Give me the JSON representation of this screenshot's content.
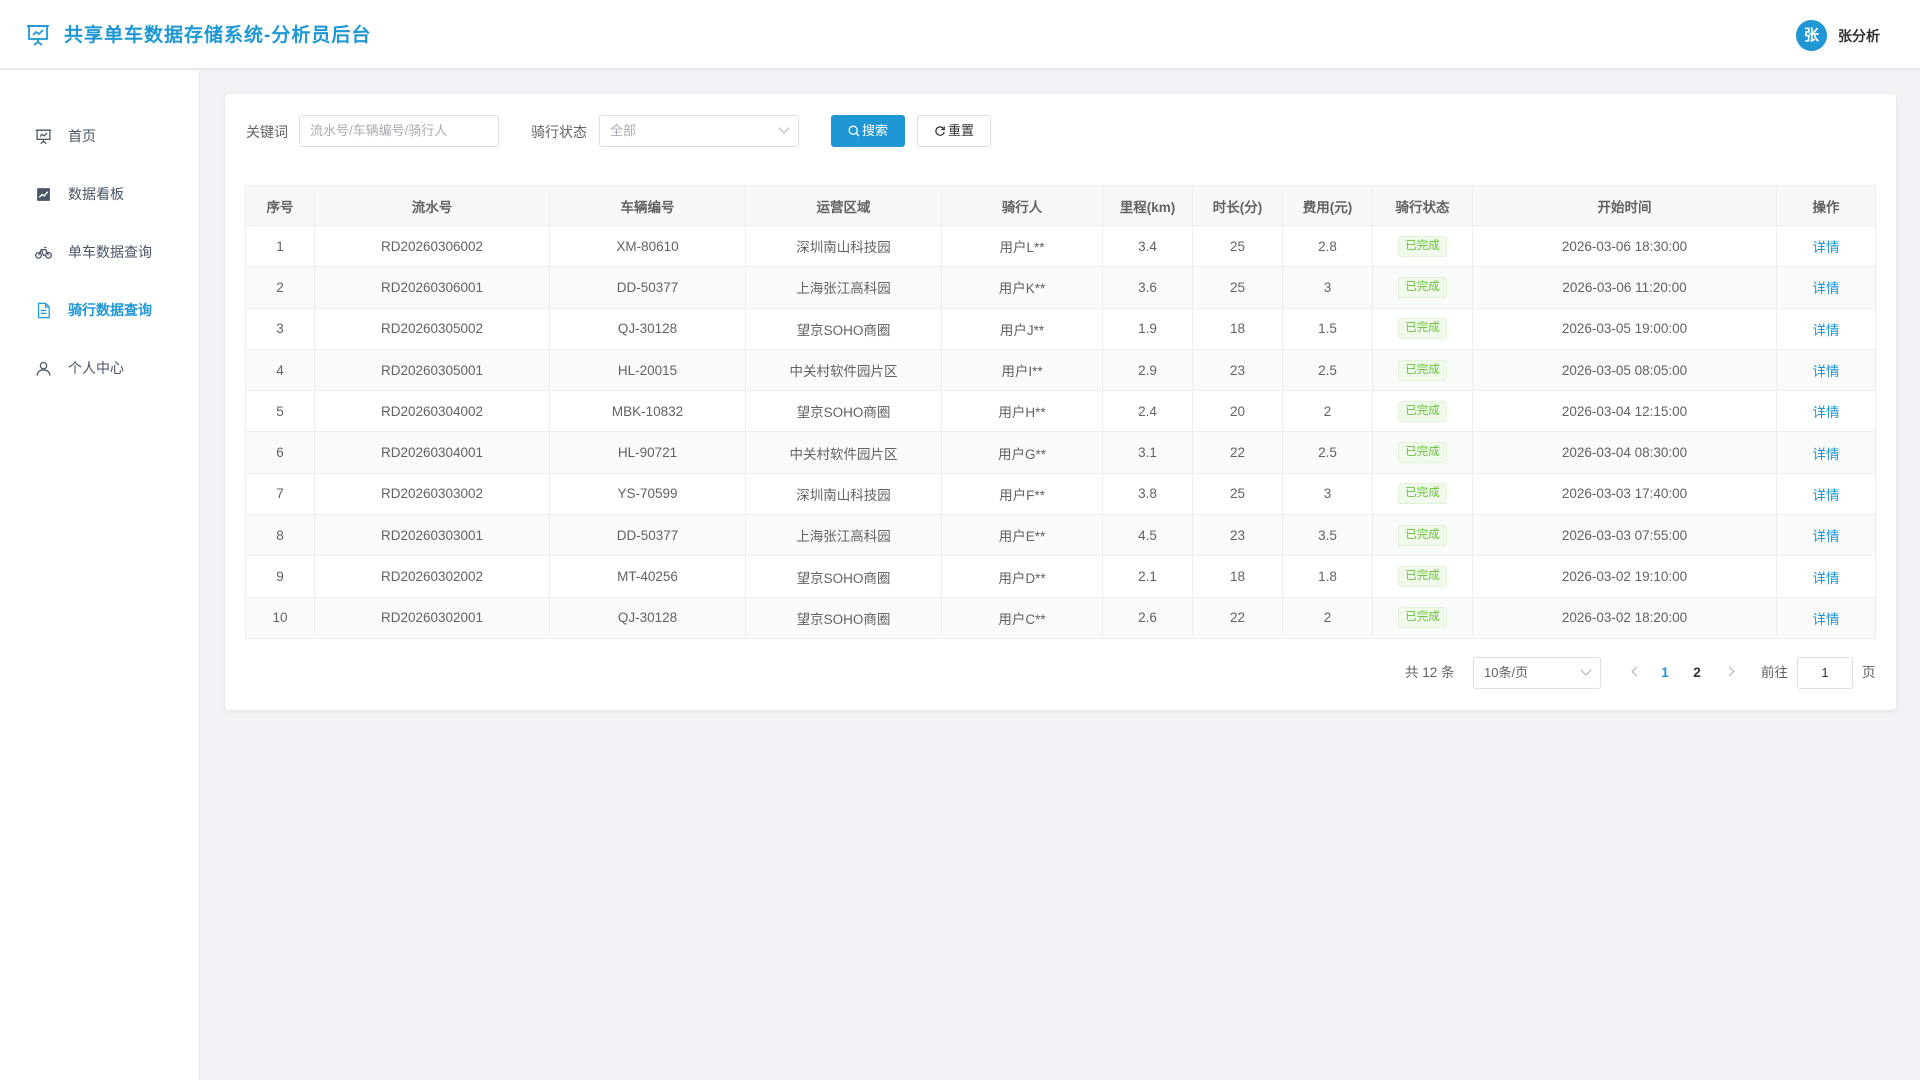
{
  "app": {
    "title": "共享单车数据存储系统-分析员后台",
    "accent_color": "#1e97d4"
  },
  "user": {
    "avatar_initial": "张",
    "name": "张分析"
  },
  "sidebar": {
    "items": [
      {
        "label": "首页",
        "icon": "presentation-icon",
        "active": false
      },
      {
        "label": "数据看板",
        "icon": "chart-icon",
        "active": false
      },
      {
        "label": "单车数据查询",
        "icon": "bicycle-icon",
        "active": false
      },
      {
        "label": "骑行数据查询",
        "icon": "document-icon",
        "active": true
      },
      {
        "label": "个人中心",
        "icon": "user-icon",
        "active": false
      }
    ]
  },
  "filters": {
    "keyword_label": "关键词",
    "keyword_placeholder": "流水号/车辆编号/骑行人",
    "status_label": "骑行状态",
    "status_value": "全部",
    "search_label": "搜索",
    "reset_label": "重置"
  },
  "table": {
    "columns": [
      "序号",
      "流水号",
      "车辆编号",
      "运营区域",
      "骑行人",
      "里程(km)",
      "时长(分)",
      "费用(元)",
      "骑行状态",
      "开始时间",
      "操作"
    ],
    "action_label": "详情",
    "rows": [
      {
        "idx": "1",
        "serial": "RD20260306002",
        "bike": "XM-80610",
        "area": "深圳南山科技园",
        "rider": "用户L**",
        "km": "3.4",
        "min": "25",
        "fee": "2.8",
        "status": "已完成",
        "start": "2026-03-06 18:30:00"
      },
      {
        "idx": "2",
        "serial": "RD20260306001",
        "bike": "DD-50377",
        "area": "上海张江高科园",
        "rider": "用户K**",
        "km": "3.6",
        "min": "25",
        "fee": "3",
        "status": "已完成",
        "start": "2026-03-06 11:20:00"
      },
      {
        "idx": "3",
        "serial": "RD20260305002",
        "bike": "QJ-30128",
        "area": "望京SOHO商圈",
        "rider": "用户J**",
        "km": "1.9",
        "min": "18",
        "fee": "1.5",
        "status": "已完成",
        "start": "2026-03-05 19:00:00"
      },
      {
        "idx": "4",
        "serial": "RD20260305001",
        "bike": "HL-20015",
        "area": "中关村软件园片区",
        "rider": "用户I**",
        "km": "2.9",
        "min": "23",
        "fee": "2.5",
        "status": "已完成",
        "start": "2026-03-05 08:05:00"
      },
      {
        "idx": "5",
        "serial": "RD20260304002",
        "bike": "MBK-10832",
        "area": "望京SOHO商圈",
        "rider": "用户H**",
        "km": "2.4",
        "min": "20",
        "fee": "2",
        "status": "已完成",
        "start": "2026-03-04 12:15:00"
      },
      {
        "idx": "6",
        "serial": "RD20260304001",
        "bike": "HL-90721",
        "area": "中关村软件园片区",
        "rider": "用户G**",
        "km": "3.1",
        "min": "22",
        "fee": "2.5",
        "status": "已完成",
        "start": "2026-03-04 08:30:00"
      },
      {
        "idx": "7",
        "serial": "RD20260303002",
        "bike": "YS-70599",
        "area": "深圳南山科技园",
        "rider": "用户F**",
        "km": "3.8",
        "min": "25",
        "fee": "3",
        "status": "已完成",
        "start": "2026-03-03 17:40:00"
      },
      {
        "idx": "8",
        "serial": "RD20260303001",
        "bike": "DD-50377",
        "area": "上海张江高科园",
        "rider": "用户E**",
        "km": "4.5",
        "min": "23",
        "fee": "3.5",
        "status": "已完成",
        "start": "2026-03-03 07:55:00"
      },
      {
        "idx": "9",
        "serial": "RD20260302002",
        "bike": "MT-40256",
        "area": "望京SOHO商圈",
        "rider": "用户D**",
        "km": "2.1",
        "min": "18",
        "fee": "1.8",
        "status": "已完成",
        "start": "2026-03-02 19:10:00"
      },
      {
        "idx": "10",
        "serial": "RD20260302001",
        "bike": "QJ-30128",
        "area": "望京SOHO商圈",
        "rider": "用户C**",
        "km": "2.6",
        "min": "22",
        "fee": "2",
        "status": "已完成",
        "start": "2026-03-02 18:20:00"
      }
    ]
  },
  "pagination": {
    "total_text": "共 12 条",
    "page_size": "10条/页",
    "pages": [
      "1",
      "2"
    ],
    "current_page": "1",
    "goto_label": "前往",
    "goto_value": "1",
    "page_suffix": "页"
  }
}
